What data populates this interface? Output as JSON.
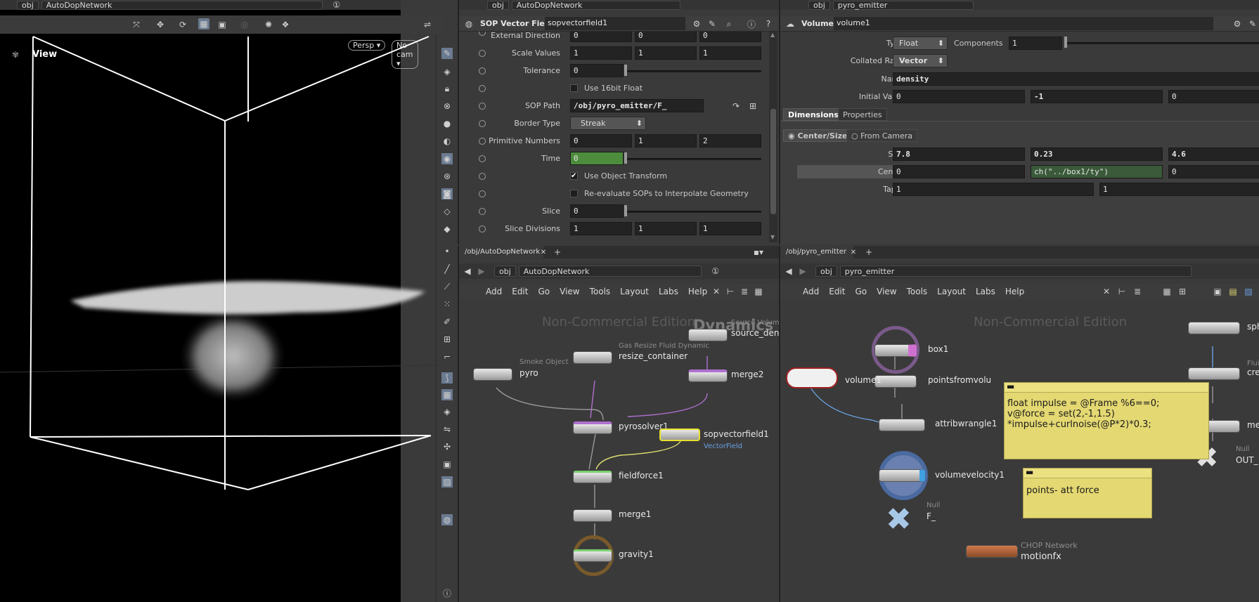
{
  "viewport": {
    "path_obj": "obj",
    "path_network": "AutoDopNetwork",
    "view_label": "View",
    "persp_label": "Persp",
    "cam_label": "No cam"
  },
  "parm_panel": {
    "path_obj": "obj",
    "path_network": "AutoDopNetwork",
    "node_type": "SOP Vector Field",
    "node_name": "sopvectorfield1",
    "rows": {
      "external_direction": {
        "label": "External Direction",
        "v": [
          "0",
          "0",
          "0"
        ]
      },
      "scale_values": {
        "label": "Scale Values",
        "v": [
          "1",
          "1",
          "1"
        ]
      },
      "tolerance": {
        "label": "Tolerance",
        "v": "0"
      },
      "use16": {
        "label": "Use 16bit Float"
      },
      "sop_path": {
        "label": "SOP Path",
        "v": "/obj/pyro_emitter/F_"
      },
      "border_type": {
        "label": "Border Type",
        "v": "Streak"
      },
      "primitive_numbers": {
        "label": "Primitive Numbers",
        "v": [
          "0",
          "1",
          "2"
        ]
      },
      "time": {
        "label": "Time",
        "v": "0"
      },
      "use_obj_xform": {
        "label": "Use Object Transform"
      },
      "reeval": {
        "label": "Re-evaluate SOPs to Interpolate Geometry"
      },
      "slice": {
        "label": "Slice",
        "v": "0"
      },
      "slice_divisions": {
        "label": "Slice Divisions",
        "v": [
          "1",
          "1",
          "1"
        ]
      }
    }
  },
  "volume_panel": {
    "path_obj": "obj",
    "path_network": "pyro_emitter",
    "node_type": "Volume",
    "node_name": "volume1",
    "type_label": "Type",
    "type_value": "Float",
    "components_label": "Components",
    "components_value": "1",
    "collated_label": "Collated Rank",
    "collated_value": "Vector",
    "name_label": "Name",
    "name_value": "density",
    "initial_label": "Initial Value",
    "initial_values": [
      "0",
      "-1",
      "0"
    ],
    "tab_dimensions": "Dimensions",
    "tab_properties": "Properties",
    "center_size": "Center/Size",
    "from_camera": "From Camera",
    "size_label": "Size",
    "size_values": [
      "7.8",
      "0.23",
      "4.6"
    ],
    "center_label": "Center",
    "center_values": [
      "0",
      "ch(\"../box1/ty\")",
      "0"
    ],
    "taper_label": "Taper",
    "taper_values": [
      "1",
      "1"
    ]
  },
  "dop_network": {
    "tab": "/obj/AutoDopNetwork",
    "path_obj": "obj",
    "path_network": "AutoDopNetwork",
    "menu": [
      "Add",
      "Edit",
      "Go",
      "View",
      "Tools",
      "Layout",
      "Labs",
      "Help"
    ],
    "watermark": "Non-Commercial Edition",
    "context": "Dynamics",
    "nodes": {
      "source": {
        "sub": "Source Volume",
        "name": "source_dens"
      },
      "resize": {
        "sub": "Gas Resize Fluid Dynamic",
        "name": "resize_container"
      },
      "merge2": {
        "name": "merge2"
      },
      "pyro": {
        "sub": "Smoke Object",
        "name": "pyro"
      },
      "pyrosolver": {
        "name": "pyrosolver1"
      },
      "sopvf": {
        "name": "sopvectorfield1",
        "sub": "VectorField"
      },
      "fieldforce": {
        "name": "fieldforce1"
      },
      "merge1": {
        "name": "merge1"
      },
      "gravity": {
        "name": "gravity1"
      }
    }
  },
  "sop_network": {
    "tab": "/obj/pyro_emitter",
    "path_obj": "obj",
    "path_network": "pyro_emitter",
    "menu": [
      "Add",
      "Edit",
      "Go",
      "View",
      "Tools",
      "Layout",
      "Labs",
      "Help"
    ],
    "watermark": "Non-Commercial Edition",
    "nodes": {
      "box1": "box1",
      "points": "pointsfromvolu",
      "volume1": "volume1",
      "attribwrangle": "attribwrangle1",
      "volumevelocity": "volumevelocity1",
      "null_sub": "Null",
      "null_name": "F_",
      "chop_sub": "CHOP Network",
      "chop_name": "motionfx",
      "sph": "sph",
      "fluid_sub": "Fluid",
      "crea": "crea",
      "me": "me",
      "null2_sub": "Null",
      "out": "OUT_"
    },
    "sticky1": [
      "float impulse = @Frame %6==0;",
      "v@force = set(2,-1,1.5)",
      "*impulse+curlnoise(@P*2)*0.3;"
    ],
    "sticky2": "points- att force"
  }
}
